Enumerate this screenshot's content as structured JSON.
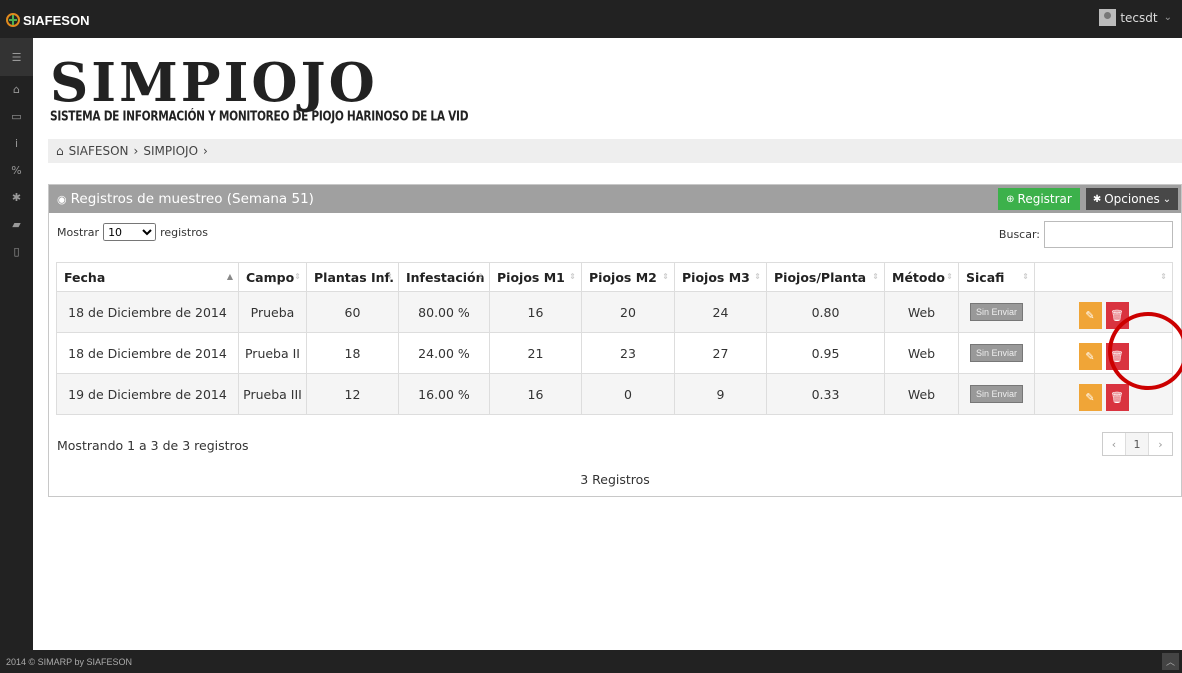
{
  "topbar": {
    "brand": "SIAFESON",
    "user": "tecsdt"
  },
  "app": {
    "title": "SIMPIOJO",
    "subtitle": "SISTEMA DE INFORMACIÓN Y MONITOREO DE PIOJO HARINOSO DE LA VID"
  },
  "breadcrumb": {
    "home": "SIAFESON",
    "sep": "›",
    "current": "SIMPIOJO"
  },
  "panel": {
    "title": "Registros de muestreo (Semana 51)",
    "register_label": "Registrar",
    "options_label": "Opciones",
    "show_label": "Mostrar",
    "page_size": "10",
    "records_label": "registros",
    "search_label": "Buscar:",
    "search_value": ""
  },
  "table": {
    "headers": [
      "Fecha",
      "Campo",
      "Plantas Inf.",
      "Infestación",
      "Piojos M1",
      "Piojos M2",
      "Piojos M3",
      "Piojos/Planta",
      "Método",
      "Sicafi",
      ""
    ],
    "rows": [
      [
        "18 de Diciembre de 2014",
        "Prueba",
        "60",
        "80.00 %",
        "16",
        "20",
        "24",
        "0.80",
        "Web",
        "Sin Enviar"
      ],
      [
        "18 de Diciembre de 2014",
        "Prueba II",
        "18",
        "24.00 %",
        "21",
        "23",
        "27",
        "0.95",
        "Web",
        "Sin Enviar"
      ],
      [
        "19 de Diciembre de 2014",
        "Prueba III",
        "12",
        "16.00 %",
        "16",
        "0",
        "9",
        "0.33",
        "Web",
        "Sin Enviar"
      ]
    ]
  },
  "footer_info": {
    "showing": "Mostrando 1 a 3 de 3 registros",
    "count": "3 Registros",
    "page": "1",
    "prev": "‹",
    "next": "›"
  },
  "footer": {
    "copyright": "2014 © SIMARP by SIAFESON"
  },
  "colors": {
    "register": "#3cb14b",
    "edit": "#f0a537",
    "delete": "#d9333f",
    "annotation": "#cc0000"
  }
}
